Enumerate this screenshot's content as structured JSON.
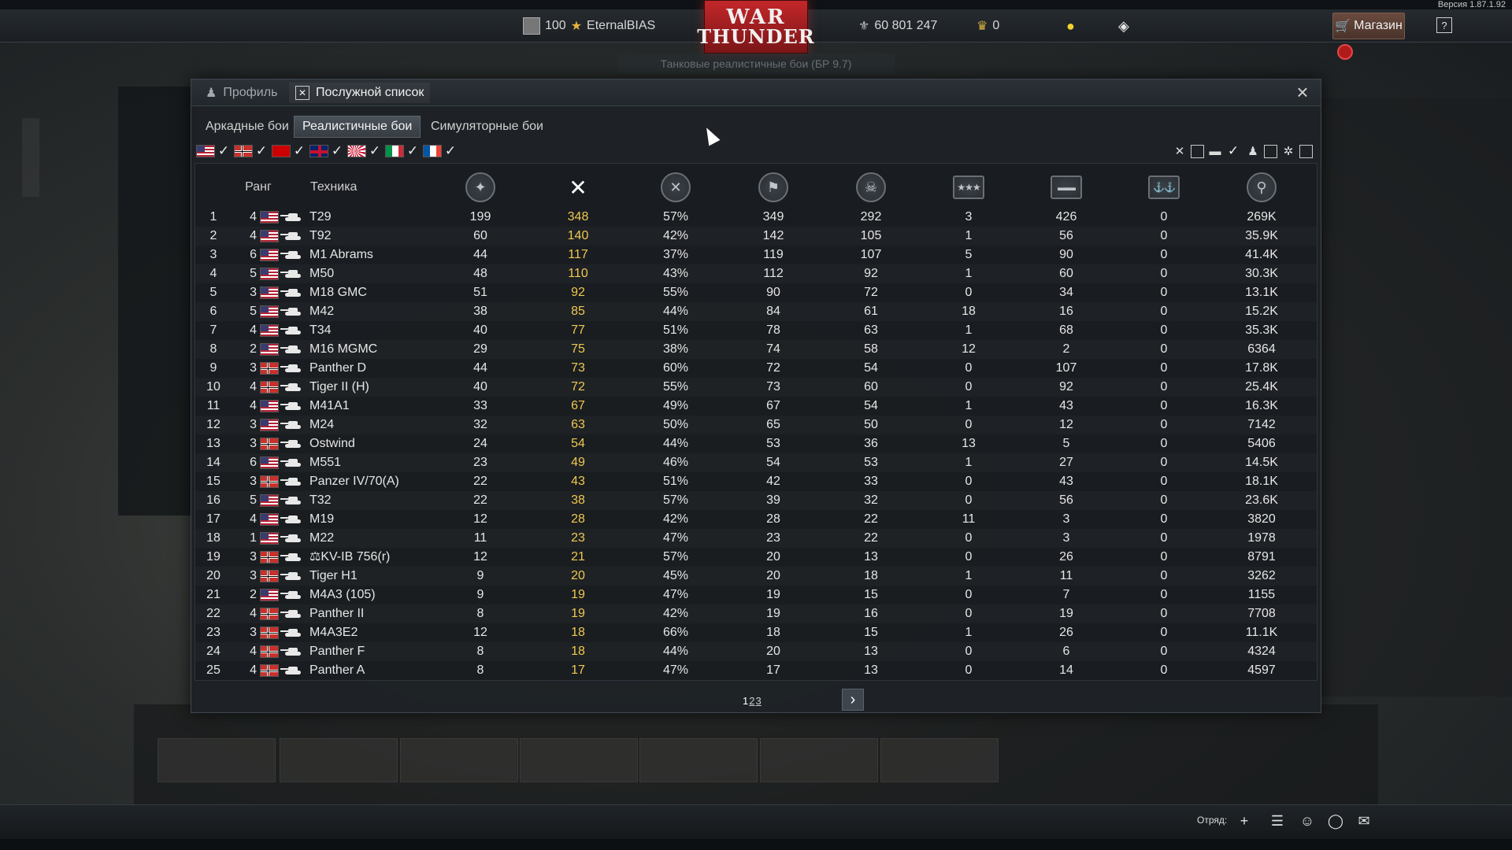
{
  "version": "Версия 1.87.1.92",
  "topbar": {
    "player_level": "100",
    "player_name": "EternalBIAS",
    "silver_lions": "60 801 247",
    "golden_eagles": "0",
    "logo_line1": "WAR",
    "logo_line2": "THUNDER",
    "shop_label": "Магазин",
    "help_label": "?"
  },
  "mode_dropdown": "Танковые реалистичные бои (БР 9.7)",
  "dialog": {
    "tabs": [
      {
        "label": "Профиль"
      },
      {
        "label": "Послужной список"
      }
    ],
    "subtabs": [
      {
        "label": "Аркадные бои"
      },
      {
        "label": "Реалистичные бои"
      },
      {
        "label": "Симуляторные бои"
      }
    ],
    "nations": [
      {
        "name": "usa",
        "checked": true
      },
      {
        "name": "germany",
        "checked": true
      },
      {
        "name": "ussr",
        "checked": true
      },
      {
        "name": "britain",
        "checked": true
      },
      {
        "name": "japan",
        "checked": true
      },
      {
        "name": "italy",
        "checked": true
      },
      {
        "name": "france",
        "checked": true
      }
    ],
    "columns": {
      "rank": "Ранг",
      "vehicle": "Техника"
    },
    "pager": {
      "pages": [
        "1",
        "2",
        "3"
      ],
      "current": "1"
    },
    "rows": [
      {
        "n": "1",
        "rank": "4",
        "nation": "usa",
        "name": "T29",
        "v": [
          "199",
          "348",
          "57%",
          "349",
          "292",
          "3",
          "426",
          "0",
          "269K"
        ]
      },
      {
        "n": "2",
        "rank": "4",
        "nation": "usa",
        "name": "T92",
        "v": [
          "60",
          "140",
          "42%",
          "142",
          "105",
          "1",
          "56",
          "0",
          "35.9K"
        ]
      },
      {
        "n": "3",
        "rank": "6",
        "nation": "usa",
        "name": "M1 Abrams",
        "v": [
          "44",
          "117",
          "37%",
          "119",
          "107",
          "5",
          "90",
          "0",
          "41.4K"
        ]
      },
      {
        "n": "4",
        "rank": "5",
        "nation": "usa",
        "name": "M50",
        "v": [
          "48",
          "110",
          "43%",
          "112",
          "92",
          "1",
          "60",
          "0",
          "30.3K"
        ]
      },
      {
        "n": "5",
        "rank": "3",
        "nation": "usa",
        "name": "M18 GMC",
        "v": [
          "51",
          "92",
          "55%",
          "90",
          "72",
          "0",
          "34",
          "0",
          "13.1K"
        ]
      },
      {
        "n": "6",
        "rank": "5",
        "nation": "usa",
        "name": "M42",
        "v": [
          "38",
          "85",
          "44%",
          "84",
          "61",
          "18",
          "16",
          "0",
          "15.2K"
        ]
      },
      {
        "n": "7",
        "rank": "4",
        "nation": "usa",
        "name": "T34",
        "v": [
          "40",
          "77",
          "51%",
          "78",
          "63",
          "1",
          "68",
          "0",
          "35.3K"
        ]
      },
      {
        "n": "8",
        "rank": "2",
        "nation": "usa",
        "name": "M16 MGMC",
        "v": [
          "29",
          "75",
          "38%",
          "74",
          "58",
          "12",
          "2",
          "0",
          "6364"
        ]
      },
      {
        "n": "9",
        "rank": "3",
        "nation": "germany",
        "name": "Panther D",
        "v": [
          "44",
          "73",
          "60%",
          "72",
          "54",
          "0",
          "107",
          "0",
          "17.8K"
        ]
      },
      {
        "n": "10",
        "rank": "4",
        "nation": "germany",
        "name": "Tiger II (H)",
        "v": [
          "40",
          "72",
          "55%",
          "73",
          "60",
          "0",
          "92",
          "0",
          "25.4K"
        ]
      },
      {
        "n": "11",
        "rank": "4",
        "nation": "usa",
        "name": "M41A1",
        "v": [
          "33",
          "67",
          "49%",
          "67",
          "54",
          "1",
          "43",
          "0",
          "16.3K"
        ]
      },
      {
        "n": "12",
        "rank": "3",
        "nation": "usa",
        "name": "M24",
        "v": [
          "32",
          "63",
          "50%",
          "65",
          "50",
          "0",
          "12",
          "0",
          "7142"
        ]
      },
      {
        "n": "13",
        "rank": "3",
        "nation": "germany",
        "name": "Ostwind",
        "v": [
          "24",
          "54",
          "44%",
          "53",
          "36",
          "13",
          "5",
          "0",
          "5406"
        ]
      },
      {
        "n": "14",
        "rank": "6",
        "nation": "usa",
        "name": "M551",
        "v": [
          "23",
          "49",
          "46%",
          "54",
          "53",
          "1",
          "27",
          "0",
          "14.5K"
        ]
      },
      {
        "n": "15",
        "rank": "3",
        "nation": "germany",
        "name": "Panzer IV/70(A)",
        "v": [
          "22",
          "43",
          "51%",
          "42",
          "33",
          "0",
          "43",
          "0",
          "18.1K"
        ]
      },
      {
        "n": "16",
        "rank": "5",
        "nation": "usa",
        "name": "T32",
        "v": [
          "22",
          "38",
          "57%",
          "39",
          "32",
          "0",
          "56",
          "0",
          "23.6K"
        ]
      },
      {
        "n": "17",
        "rank": "4",
        "nation": "usa",
        "name": "M19",
        "v": [
          "12",
          "28",
          "42%",
          "28",
          "22",
          "11",
          "3",
          "0",
          "3820"
        ]
      },
      {
        "n": "18",
        "rank": "1",
        "nation": "usa",
        "name": "M22",
        "v": [
          "11",
          "23",
          "47%",
          "23",
          "22",
          "0",
          "3",
          "0",
          "1978"
        ]
      },
      {
        "n": "19",
        "rank": "3",
        "nation": "germany",
        "name": "⚖KV-IB 756(r)",
        "v": [
          "12",
          "21",
          "57%",
          "20",
          "13",
          "0",
          "26",
          "0",
          "8791"
        ]
      },
      {
        "n": "20",
        "rank": "3",
        "nation": "germany",
        "name": "Tiger H1",
        "v": [
          "9",
          "20",
          "45%",
          "20",
          "18",
          "1",
          "11",
          "0",
          "3262"
        ]
      },
      {
        "n": "21",
        "rank": "2",
        "nation": "usa",
        "name": "M4A3 (105)",
        "v": [
          "9",
          "19",
          "47%",
          "19",
          "15",
          "0",
          "7",
          "0",
          "1155"
        ]
      },
      {
        "n": "22",
        "rank": "4",
        "nation": "germany",
        "name": "Panther II",
        "v": [
          "8",
          "19",
          "42%",
          "19",
          "16",
          "0",
          "19",
          "0",
          "7708"
        ]
      },
      {
        "n": "23",
        "rank": "3",
        "nation": "germany",
        "name": "M4A3E2",
        "v": [
          "12",
          "18",
          "66%",
          "18",
          "15",
          "1",
          "26",
          "0",
          "11.1K"
        ]
      },
      {
        "n": "24",
        "rank": "4",
        "nation": "germany",
        "name": "Panther F",
        "v": [
          "8",
          "18",
          "44%",
          "20",
          "13",
          "0",
          "6",
          "0",
          "4324"
        ]
      },
      {
        "n": "25",
        "rank": "4",
        "nation": "germany",
        "name": "Panther A",
        "v": [
          "8",
          "17",
          "47%",
          "17",
          "13",
          "0",
          "14",
          "0",
          "4597"
        ]
      }
    ]
  },
  "bottombar": {
    "squad_label": "Отряд:"
  },
  "colors": {
    "accent_selected_column": "#f0c850",
    "logo_red": "#c3272a"
  }
}
